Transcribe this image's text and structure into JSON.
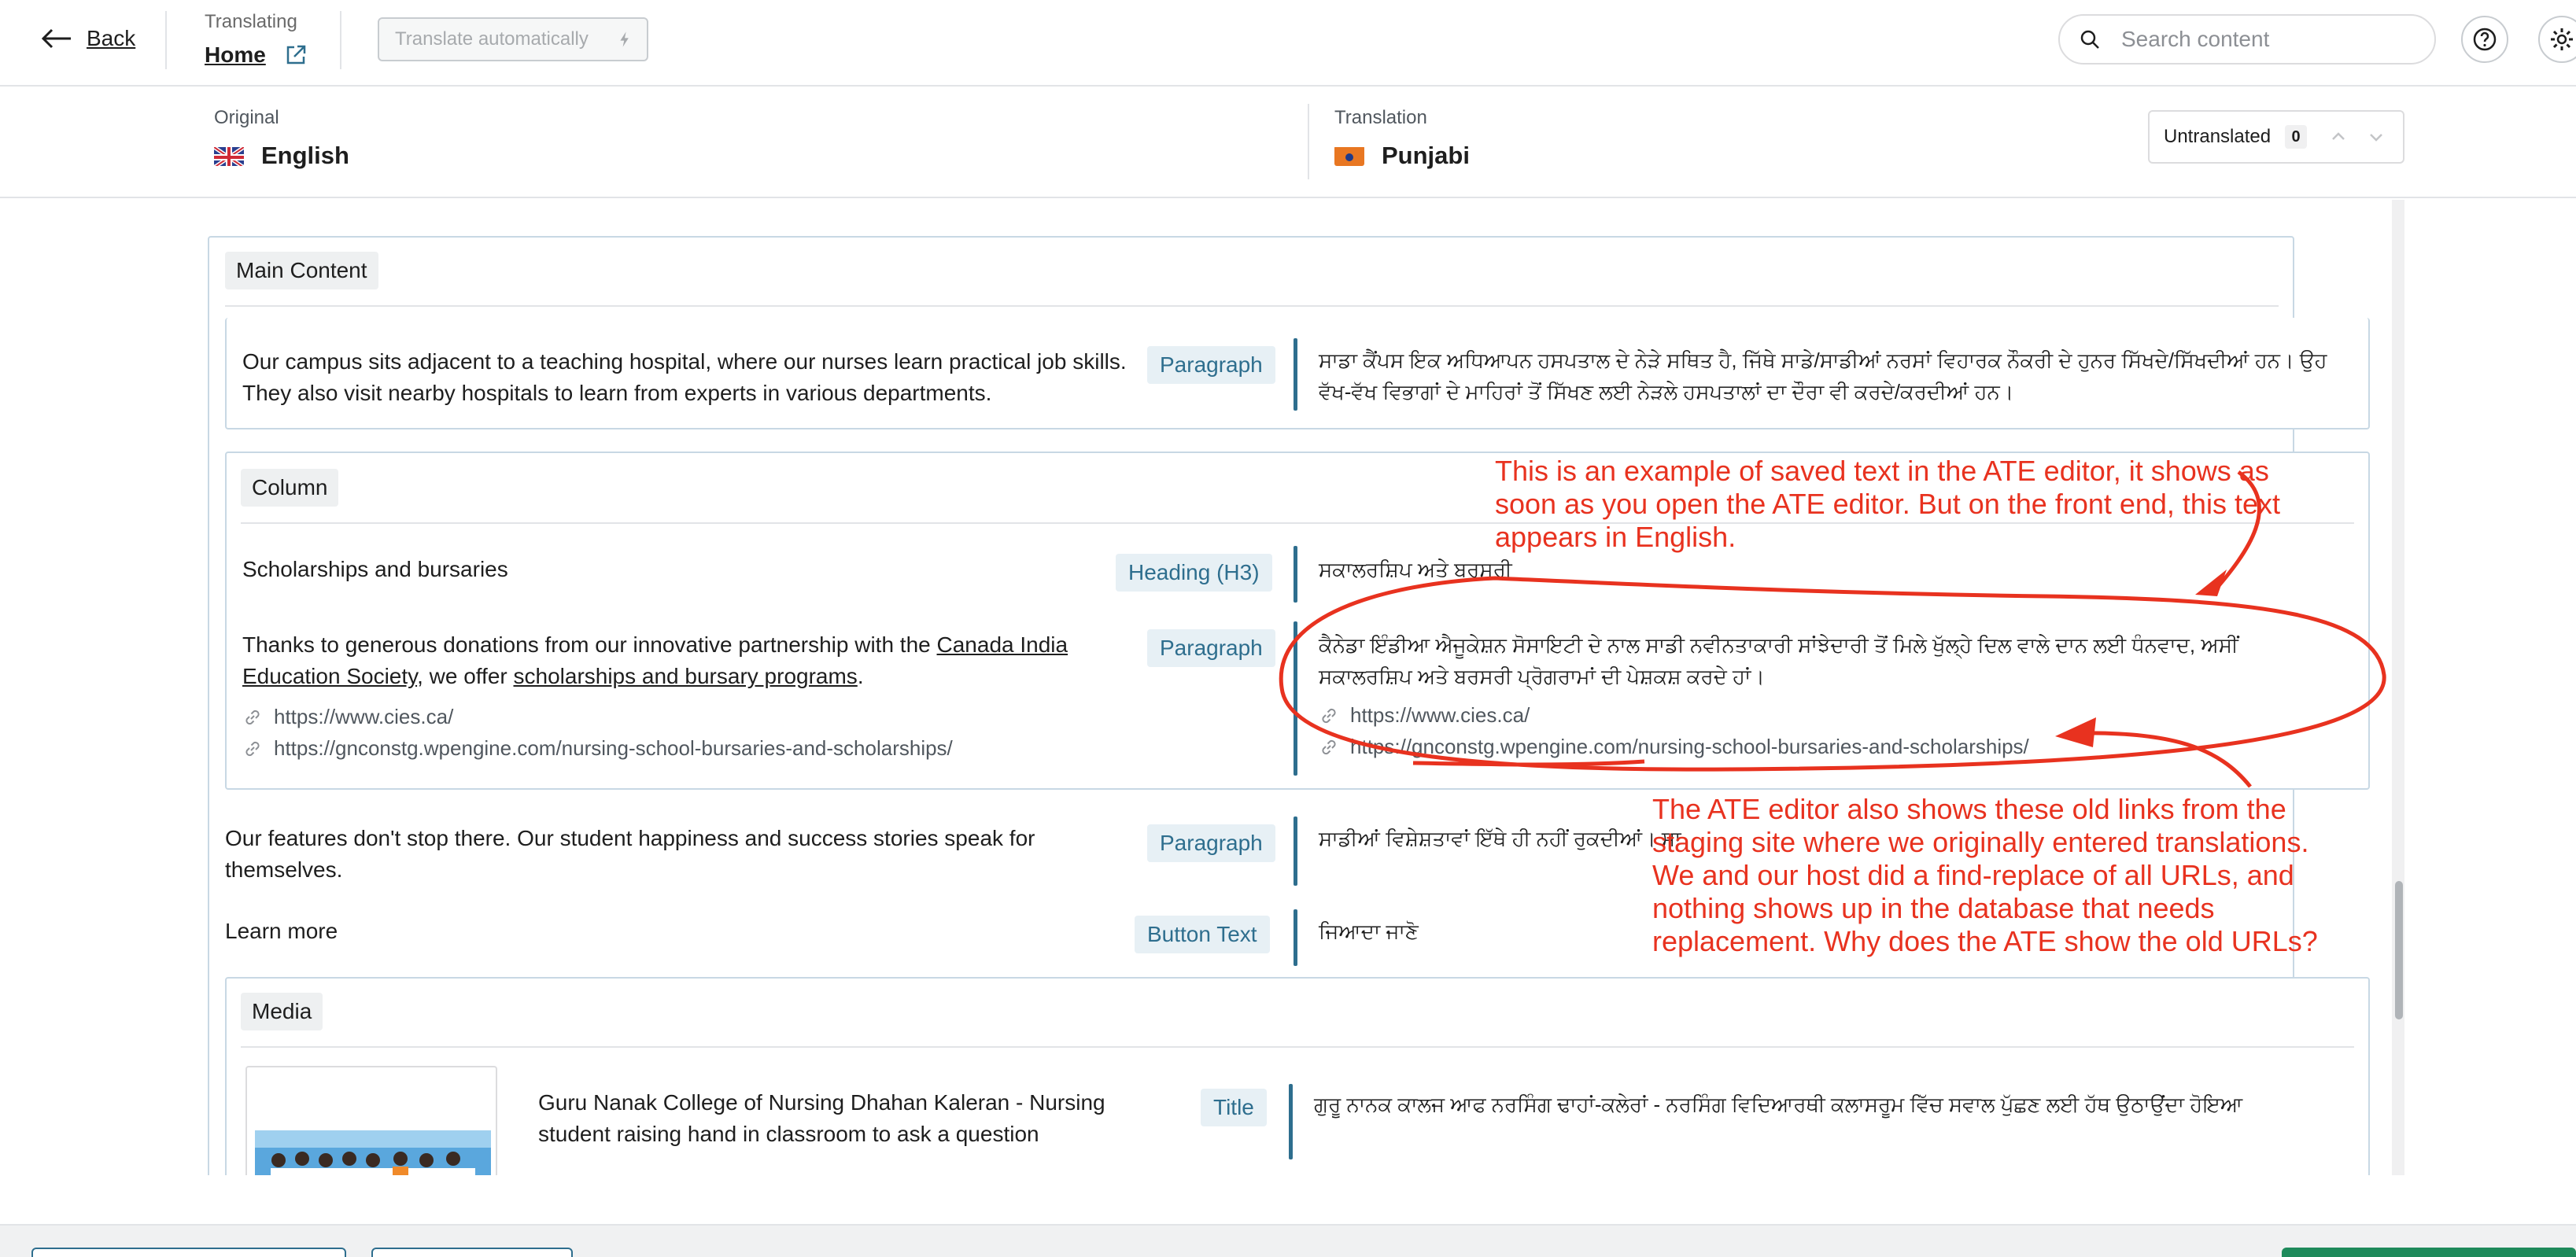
{
  "topbar": {
    "back_label": "Back",
    "translating_label": "Translating",
    "page_name": "Home",
    "translate_auto_label": "Translate automatically",
    "search_placeholder": "Search content"
  },
  "languages": {
    "original_label": "Original",
    "original_name": "English",
    "translation_label": "Translation",
    "translation_name": "Punjabi",
    "filter_label": "Untranslated",
    "filter_count": "0"
  },
  "sections": {
    "main_content": "Main Content",
    "column": "Column",
    "media": "Media"
  },
  "rows": {
    "campus": {
      "source": "Our campus sits adjacent to a teaching hospital, where our nurses learn practical job skills. They also visit nearby hospitals to learn from experts in various departments.",
      "type": "Paragraph",
      "translation": "ਸਾਡਾ ਕੈਂਪਸ ਇਕ ਅਧਿਆਪਨ ਹਸਪਤਾਲ ਦੇ ਨੇੜੇ ਸਥਿਤ ਹੈ, ਜਿੱਥੇ ਸਾਡੇ/ਸਾਡੀਆਂ ਨਰਸਾਂ ਵਿਹਾਰਕ ਨੌਕਰੀ ਦੇ ਹੁਨਰ ਸਿੱਖਦੇ/ਸਿੱਖਦੀਆਂ ਹਨ। ਉਹ ਵੱਖ-ਵੱਖ ਵਿਭਾਗਾਂ ਦੇ ਮਾਹਿਰਾਂ ਤੋਂ ਸਿੱਖਣ ਲਈ ਨੇੜਲੇ ਹਸਪਤਾਲਾਂ ਦਾ ਦੌਰਾ ਵੀ ਕਰਦੇ/ਕਰਦੀਆਂ ਹਨ।"
    },
    "scholarships": {
      "source": "Scholarships and bursaries",
      "type": "Heading (H3)",
      "translation": "ਸਕਾਲਰਸ਼ਿਪ ਅਤੇ ਬਰਸਰੀ"
    },
    "donations": {
      "source_pre": "Thanks to generous donations from our innovative partnership with the ",
      "source_link1": "Canada India Education Society",
      "source_mid": ", we offer ",
      "source_link2": "scholarships and bursary programs",
      "source_post": ".",
      "link_a": "https://www.cies.ca/",
      "link_b": "https://gnconstg.wpengine.com/nursing-school-bursaries-and-scholarships/",
      "type": "Paragraph",
      "translation": "ਕੈਨੇਡਾ ਇੰਡੀਆ ਐਜੂਕੇਸ਼ਨ ਸੋਸਾਇਟੀ ਦੇ ਨਾਲ ਸਾਡੀ ਨਵੀਨਤਾਕਾਰੀ ਸਾਂਝੇਦਾਰੀ ਤੋਂ ਮਿਲੇ ਖੁੱਲ੍ਹੇ ਦਿਲ ਵਾਲੇ ਦਾਨ ਲਈ ਧੰਨਵਾਦ, ਅਸੀਂ ਸਕਾਲਰਸ਼ਿਪ ਅਤੇ ਬਰਸਰੀ ਪ੍ਰੋਗਰਾਮਾਂ ਦੀ ਪੇਸ਼ਕਸ਼ ਕਰਦੇ ਹਾਂ।",
      "trans_link_a": "https://www.cies.ca/",
      "trans_link_b": "https://gnconstg.wpengine.com/nursing-school-bursaries-and-scholarships/"
    },
    "features": {
      "source": "Our features don't stop there. Our student happiness and success stories speak for themselves.",
      "type": "Paragraph",
      "translation": "ਸਾਡੀਆਂ ਵਿਸ਼ੇਸ਼ਤਾਵਾਂ ਇੱਥੇ ਹੀ ਨਹੀਂ ਰੁਕਦੀਆਂ। ਸਾ"
    },
    "learn_more": {
      "source": "Learn more",
      "type": "Button Text",
      "translation": "ਜਿਆਦਾ ਜਾਣੋ"
    },
    "media_title": {
      "source": "Guru Nanak College of Nursing Dhahan Kaleran - Nursing student raising hand in classroom to ask a question",
      "type": "Title",
      "translation": "ਗੁਰੂ ਨਾਨਕ ਕਾਲਜ ਆਫ ਨਰਸਿੰਗ ਢਾਹਾਂ-ਕਲੇਰਾਂ - ਨਰਸਿੰਗ ਵਿਦਿਆਰਥੀ ਕਲਾਸਰੂਮ ਵਿੱਚ ਸਵਾਲ ਪੁੱਛਣ ਲਈ ਹੱਥ ਉਠਾਉਂਦਾ ਹੋਇਆ"
    }
  },
  "annotations": {
    "note1": "This is an example of saved text in the ATE editor, it shows as soon as you open the ATE editor. But on the front end, this text appears in English.",
    "note2": "The ATE editor also shows these old links from the staging site where we originally entered translations. We and our host did a find-replace of all URLs, and nothing shows up in the database that needs replacement. Why does the ATE show the old URLs?"
  },
  "icons": [
    "arrow-left-icon",
    "external-link-icon",
    "lightning-icon",
    "search-icon",
    "help-icon",
    "gear-icon",
    "chevron-up-icon",
    "chevron-down-icon",
    "link-icon"
  ],
  "colors": {
    "accent": "#2e6e8e",
    "annotation": "#e8321f",
    "tag_bg": "#e7f0f5"
  }
}
